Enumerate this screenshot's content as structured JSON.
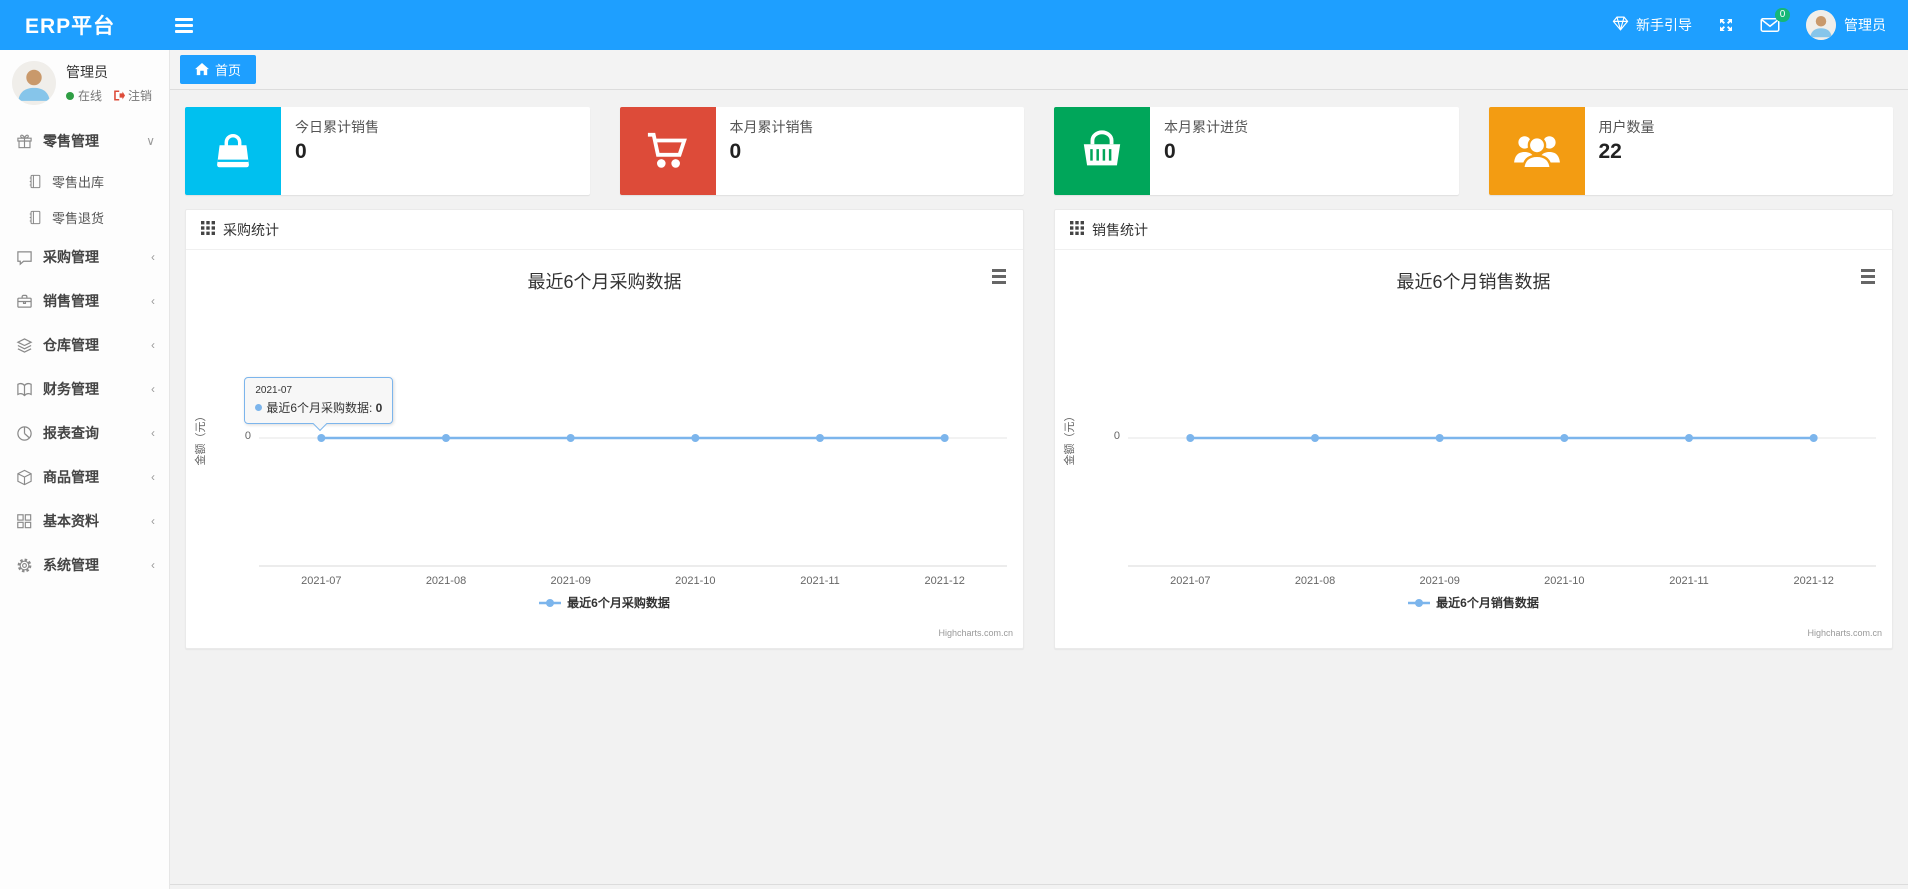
{
  "colors": {
    "navbar": "#1e9fff",
    "badge_green": "#16b777",
    "chart_line": "#7cb5ec"
  },
  "navbar": {
    "brand": "ERP平台",
    "guide": "新手引导",
    "mail_badge": "0",
    "username": "管理员"
  },
  "sidebar": {
    "user": {
      "name": "管理员",
      "status": "在线",
      "logout": "注销"
    },
    "items": [
      {
        "label": "零售管理",
        "icon": "gift-icon",
        "chevron": "down",
        "children": [
          {
            "label": "零售出库",
            "icon": "notebook-icon"
          },
          {
            "label": "零售退货",
            "icon": "notebook-icon"
          }
        ]
      },
      {
        "label": "采购管理",
        "icon": "chat-icon",
        "chevron": "left",
        "children": []
      },
      {
        "label": "销售管理",
        "icon": "briefcase-icon",
        "chevron": "left",
        "children": []
      },
      {
        "label": "仓库管理",
        "icon": "layers-icon",
        "chevron": "left",
        "children": []
      },
      {
        "label": "财务管理",
        "icon": "book-icon",
        "chevron": "left",
        "children": []
      },
      {
        "label": "报表查询",
        "icon": "pie-icon",
        "chevron": "left",
        "children": []
      },
      {
        "label": "商品管理",
        "icon": "box-icon",
        "chevron": "left",
        "children": []
      },
      {
        "label": "基本资料",
        "icon": "grid-icon",
        "chevron": "left",
        "children": []
      },
      {
        "label": "系统管理",
        "icon": "gear-icon",
        "chevron": "left",
        "children": []
      }
    ]
  },
  "breadcrumb": {
    "home": "首页"
  },
  "stat_cards": [
    {
      "label": "今日累计销售",
      "value": "0",
      "color": "#00c0ef",
      "icon": "bag-icon"
    },
    {
      "label": "本月累计销售",
      "value": "0",
      "color": "#dd4b39",
      "icon": "cart-icon"
    },
    {
      "label": "本月累计进货",
      "value": "0",
      "color": "#00a65a",
      "icon": "basket-icon"
    },
    {
      "label": "用户数量",
      "value": "22",
      "color": "#f39c12",
      "icon": "users-icon"
    }
  ],
  "panels": [
    {
      "title": "采购统计"
    },
    {
      "title": "销售统计"
    }
  ],
  "credit": "Highcharts.com.cn",
  "chart_data": [
    {
      "type": "line",
      "title": "最近6个月采购数据",
      "categories": [
        "2021-07",
        "2021-08",
        "2021-09",
        "2021-10",
        "2021-11",
        "2021-12"
      ],
      "series": [
        {
          "name": "最近6个月采购数据",
          "values": [
            0,
            0,
            0,
            0,
            0,
            0
          ],
          "color": "#7cb5ec"
        }
      ],
      "ylabel": "金额（元）",
      "yticks": [
        0
      ],
      "ylim": [
        -1,
        1
      ],
      "grid": false,
      "legend_position": "bottom",
      "tooltip": {
        "category": "2021-07",
        "series_name": "最近6个月采购数据",
        "value": 0
      }
    },
    {
      "type": "line",
      "title": "最近6个月销售数据",
      "categories": [
        "2021-07",
        "2021-08",
        "2021-09",
        "2021-10",
        "2021-11",
        "2021-12"
      ],
      "series": [
        {
          "name": "最近6个月销售数据",
          "values": [
            0,
            0,
            0,
            0,
            0,
            0
          ],
          "color": "#7cb5ec"
        }
      ],
      "ylabel": "金额（元）",
      "yticks": [
        0
      ],
      "ylim": [
        -1,
        1
      ],
      "grid": false,
      "legend_position": "bottom",
      "tooltip": null
    }
  ]
}
